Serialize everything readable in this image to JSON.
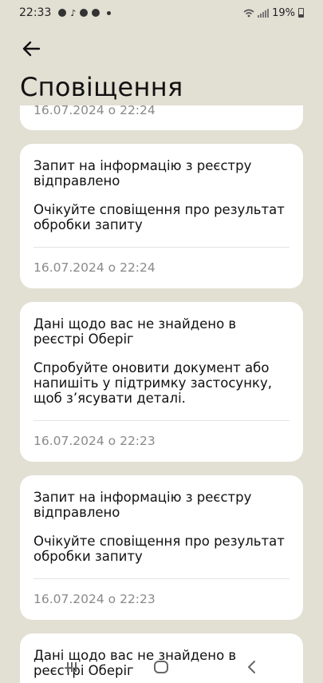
{
  "status": {
    "time": "22:33",
    "battery": "19%"
  },
  "header": {
    "title": "Сповіщення"
  },
  "notifications": [
    {
      "title": "",
      "body": "",
      "date": "16.07.2024 о 22:24"
    },
    {
      "title": "Запит на інформацію з реєстру відправлено",
      "body": "Очікуйте сповіщення про результат обробки запиту",
      "date": "16.07.2024 о 22:24"
    },
    {
      "title": "Дані щодо вас не знайдено в реєстрі Оберіг",
      "body": "Спробуйте оновити документ або напишіть у підтримку застосунку, щоб з’ясувати деталі.",
      "date": "16.07.2024 о 22:23"
    },
    {
      "title": "Запит на інформацію з реєстру відправлено",
      "body": "Очікуйте сповіщення про результат обробки запиту",
      "date": "16.07.2024 о 22:23"
    },
    {
      "title": "Дані щодо вас не знайдено в реєстрі Оберіг",
      "body": "",
      "date": ""
    }
  ],
  "colors": {
    "background": "#e2dfd3",
    "card": "#ffffff",
    "date_text": "#8a8a8a"
  }
}
